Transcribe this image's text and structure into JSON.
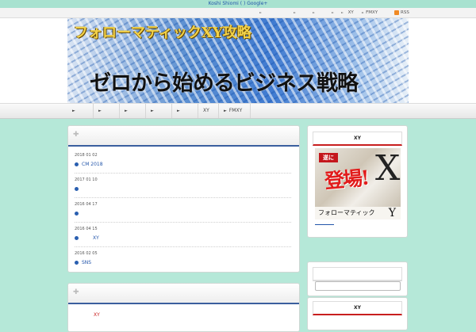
{
  "topbar": {
    "link": "Koshi Shiomi ( ) Google+"
  },
  "utilbar": {
    "items": [
      "",
      "",
      "",
      "",
      "XY",
      "FMXY"
    ],
    "rss": "RSS"
  },
  "banner": {
    "subtitle": "フォローマティックXY攻略",
    "title": "ゼロから始めるビジネス戦略"
  },
  "nav": {
    "items": [
      "",
      "",
      "",
      "",
      "",
      "XY",
      "FMXY"
    ]
  },
  "posts": [
    {
      "date": "2018 01 02",
      "title": "CM            2018"
    },
    {
      "date": "2017 01 10",
      "title": ""
    },
    {
      "date": "2016 04 17",
      "title": ""
    },
    {
      "date": "2016 04 15",
      "title": "XY"
    },
    {
      "date": "2016 02 05",
      "title": "SNS"
    }
  ],
  "second_panel": {
    "item": "XY"
  },
  "sidebar": {
    "box1_title": "XY",
    "promo": {
      "tag": "遂に",
      "big": "登場!",
      "brand": "フォローマティック",
      "letter_x": "X",
      "letter_y": "Y"
    },
    "box3_title": "XY"
  },
  "colors": {
    "accent_blue": "#3a5f9e",
    "accent_red": "#c81e1e",
    "background": "#b5e8d8"
  }
}
